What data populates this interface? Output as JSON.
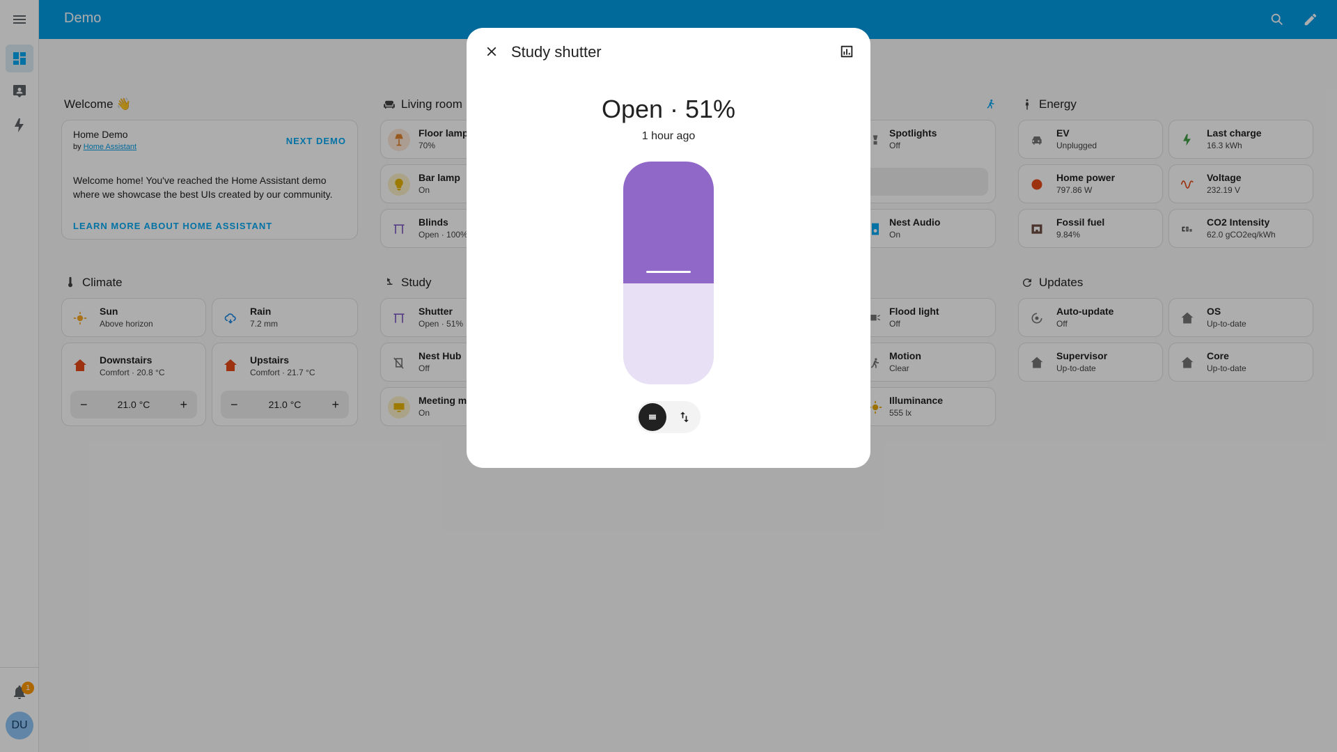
{
  "header": {
    "title": "Demo"
  },
  "sidebar": {
    "badge_count": "1",
    "avatar_initials": "DU"
  },
  "welcome": {
    "section_title": "Welcome 👋",
    "heading": "Home Demo",
    "by_prefix": "by ",
    "by_link": "Home Assistant",
    "next_demo": "NEXT DEMO",
    "body": "Welcome home! You've reached the Home Assistant demo where we showcase the best UIs created by our community.",
    "learn_more": "LEARN MORE ABOUT HOME ASSISTANT"
  },
  "living_room": {
    "section_title": "Living room",
    "tiles": [
      {
        "name": "Floor lamp",
        "state": "70%"
      },
      {
        "name": "Bar lamp",
        "state": "On"
      },
      {
        "name": "Blinds",
        "state": "Open · 100%"
      }
    ]
  },
  "climate": {
    "section_title": "Climate",
    "tiles": [
      {
        "name": "Sun",
        "state": "Above horizon"
      },
      {
        "name": "Rain",
        "state": "7.2 mm"
      }
    ],
    "thermostats": [
      {
        "name": "Downstairs",
        "state": "Comfort · 20.8 °C",
        "target": "21.0 °C",
        "minus": "−",
        "plus": "+"
      },
      {
        "name": "Upstairs",
        "state": "Comfort · 21.7 °C",
        "target": "21.0 °C",
        "minus": "−",
        "plus": "+"
      }
    ]
  },
  "study": {
    "section_title": "Study",
    "tiles": [
      {
        "name": "Shutter",
        "state": "Open · 51%"
      },
      {
        "name": "Nest Hub",
        "state": "Off"
      },
      {
        "name": "Meeting m",
        "state": "On"
      }
    ]
  },
  "third_column": {
    "tiles_top": [
      {
        "name": "Spotlights",
        "state": "Off"
      },
      {
        "name": "Nest Audio",
        "state": "On"
      }
    ],
    "tiles_bottom": [
      {
        "name": "Flood light",
        "state": "Off"
      },
      {
        "name": "Motion",
        "state": "Clear"
      },
      {
        "name": "Illuminance",
        "state": "555 lx"
      }
    ]
  },
  "energy": {
    "section_title": "Energy",
    "tiles": [
      {
        "name": "EV",
        "state": "Unplugged"
      },
      {
        "name": "Last charge",
        "state": "16.3 kWh"
      },
      {
        "name": "Home power",
        "state": "797.86 W"
      },
      {
        "name": "Voltage",
        "state": "232.19 V"
      },
      {
        "name": "Fossil fuel",
        "state": "9.84%"
      },
      {
        "name": "CO2 Intensity",
        "state": "62.0 gCO2eq/kWh"
      }
    ]
  },
  "updates": {
    "section_title": "Updates",
    "tiles": [
      {
        "name": "Auto-update",
        "state": "Off"
      },
      {
        "name": "OS",
        "state": "Up-to-date"
      },
      {
        "name": "Supervisor",
        "state": "Up-to-date"
      },
      {
        "name": "Core",
        "state": "Up-to-date"
      }
    ]
  },
  "dialog": {
    "title": "Study shutter",
    "state": "Open · 51%",
    "last_changed": "1 hour ago",
    "position_fraction": 0.51
  },
  "colors": {
    "accent": "#03a9f4",
    "header": "#039be5",
    "shutter_fill": "#9069c8",
    "shutter_track": "#e8e0f4"
  }
}
